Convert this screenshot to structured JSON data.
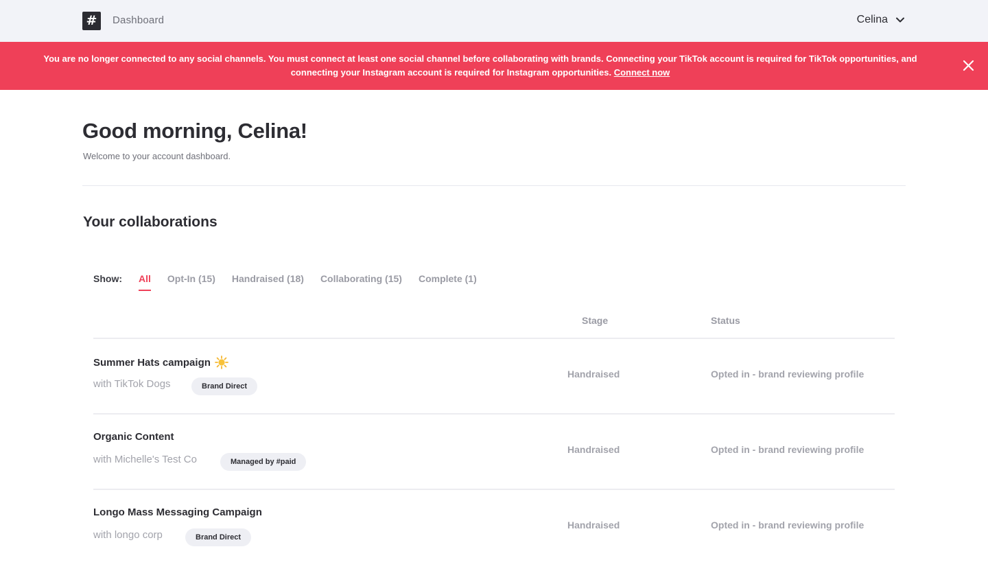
{
  "header": {
    "logo_glyph": "#",
    "title": "Dashboard",
    "user_name": "Celina"
  },
  "banner": {
    "message_line1": "You are no longer connected to any social channels. You must connect at least one social channel before collaborating with brands. Connecting your TikTok account is required for TikTok opportunities, and",
    "message_line2": "connecting your Instagram account is required for Instagram opportunities.",
    "link_label": "Connect now",
    "color": "#ef4058"
  },
  "greeting": {
    "title": "Good morning, Celina!",
    "subtitle": "Welcome to your account dashboard."
  },
  "collaborations": {
    "title": "Your collaborations",
    "filter_label": "Show:",
    "filters": [
      {
        "label": "All",
        "active": true
      },
      {
        "label": "Opt-In (15)",
        "active": false
      },
      {
        "label": "Handraised (18)",
        "active": false
      },
      {
        "label": "Collaborating (15)",
        "active": false
      },
      {
        "label": "Complete (1)",
        "active": false
      }
    ],
    "columns": {
      "stage": "Stage",
      "status": "Status"
    },
    "rows": [
      {
        "title": "Summer Hats campaign",
        "icon": "sun-icon",
        "partner": "with TikTok Dogs",
        "badge": "Brand Direct",
        "stage": "Handraised",
        "status": "Opted in - brand reviewing profile"
      },
      {
        "title": "Organic Content",
        "partner": "with Michelle's Test Co",
        "badge": "Managed by #paid",
        "stage": "Handraised",
        "status": "Opted in - brand reviewing profile"
      },
      {
        "title": "Longo Mass Messaging Campaign",
        "partner": "with longo corp",
        "badge": "Brand Direct",
        "stage": "Handraised",
        "status": "Opted in - brand reviewing profile"
      }
    ]
  },
  "colors": {
    "accent": "#ef4058",
    "topbar_bg": "#f2f3f8",
    "badge_bg": "#eeeff4"
  }
}
